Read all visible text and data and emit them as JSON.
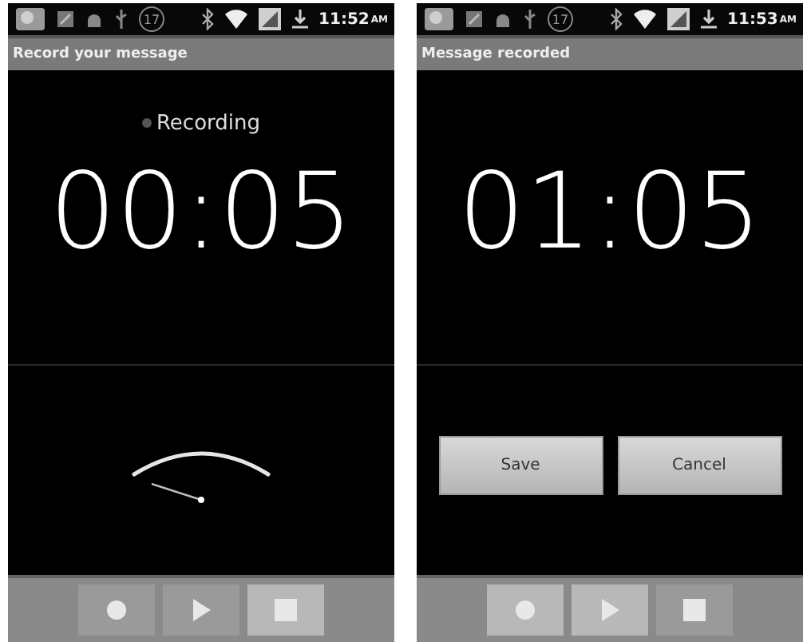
{
  "phones": [
    {
      "status_bar": {
        "badge": "17",
        "time": "11:52",
        "ampm": "AM"
      },
      "title": "Record your message",
      "indicator": {
        "label": "Recording",
        "on": false
      },
      "timer": "00:05",
      "lower": {
        "kind": "meter"
      },
      "transport": [
        {
          "kind": "record",
          "disabled": true
        },
        {
          "kind": "play",
          "disabled": true
        },
        {
          "kind": "stop",
          "disabled": false
        }
      ]
    },
    {
      "status_bar": {
        "badge": "17",
        "time": "11:53",
        "ampm": "AM"
      },
      "title": "Message recorded",
      "timer": "01:05",
      "lower": {
        "kind": "actions",
        "buttons": [
          "Save",
          "Cancel"
        ]
      },
      "transport": [
        {
          "kind": "record",
          "disabled": false
        },
        {
          "kind": "play",
          "disabled": false
        },
        {
          "kind": "stop",
          "disabled": true
        }
      ]
    }
  ]
}
